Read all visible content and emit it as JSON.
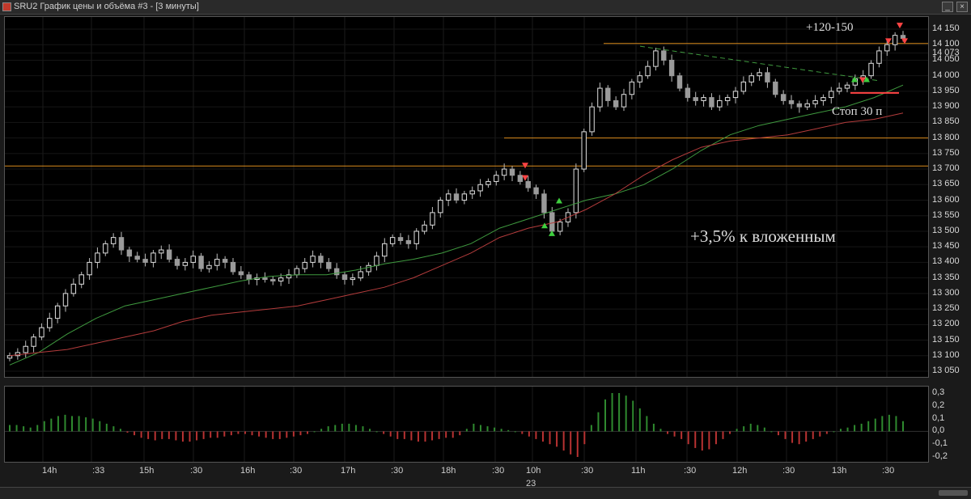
{
  "window": {
    "title": "SRU2 График цены и объёма #3 - [3 минуты]",
    "minimize_label": "_",
    "close_label": "×"
  },
  "price_panel": {
    "y_ticks": [
      "14 150",
      "14 100",
      "14 073",
      "14 050",
      "14 000",
      "13 950",
      "13 900",
      "13 850",
      "13 800",
      "13 750",
      "13 700",
      "13 650",
      "13 600",
      "13 550",
      "13 500",
      "13 450",
      "13 400",
      "13 350",
      "13 300",
      "13 250",
      "13 200",
      "13 150",
      "13 100",
      "13 050"
    ],
    "y_tick_values": [
      14150,
      14100,
      14073,
      14050,
      14000,
      13950,
      13900,
      13850,
      13800,
      13750,
      13700,
      13650,
      13600,
      13550,
      13500,
      13450,
      13400,
      13350,
      13300,
      13250,
      13200,
      13150,
      13100,
      13050
    ],
    "annotations": {
      "target": "+120-150",
      "stop": "Стоп 30 п",
      "result": "+3,5% к вложенным"
    },
    "colors": {
      "target": "#4fb84f",
      "stop": "#ff4444",
      "result": "#ff9a1f",
      "level_lines": "#d98a1c",
      "ma_fast": "#3f9a3f",
      "ma_slow": "#b43c3c",
      "candle_up": "#e0e0e0",
      "candle_down": "#9a9a9a"
    }
  },
  "osc_panel": {
    "y_ticks": [
      "0,3",
      "0,2",
      "0,1",
      "0,0",
      "-0,1",
      "-0,2"
    ],
    "y_tick_values": [
      0.3,
      0.2,
      0.1,
      0.0,
      -0.1,
      -0.2
    ],
    "colors": {
      "positive": "#2f8a2f",
      "negative": "#b83232"
    }
  },
  "x_axis": {
    "ticks": [
      "14h",
      ":33",
      "15h",
      ":30",
      "16h",
      ":30",
      "17h",
      ":30",
      "18h",
      ":30",
      "10h",
      ":30",
      "11h",
      ":30",
      "12h",
      ":30",
      "13h",
      ":30"
    ],
    "date_label": "23"
  },
  "chart_data": [
    {
      "type": "candlestick",
      "title": "",
      "symbol": "SRU2",
      "timeframe": "3 минуты",
      "ylim": [
        13040,
        14170
      ],
      "levels": [
        14104,
        13800,
        13710
      ],
      "series_candles_close_approx": [
        13100,
        13110,
        13130,
        13160,
        13190,
        13220,
        13260,
        13300,
        13330,
        13360,
        13400,
        13430,
        13460,
        13480,
        13440,
        13420,
        13410,
        13400,
        13430,
        13440,
        13410,
        13390,
        13400,
        13420,
        13380,
        13390,
        13410,
        13400,
        13370,
        13360,
        13345,
        13350,
        13345,
        13340,
        13350,
        13360,
        13380,
        13400,
        13420,
        13400,
        13380,
        13360,
        13345,
        13350,
        13370,
        13390,
        13420,
        13460,
        13480,
        13470,
        13460,
        13500,
        13520,
        13560,
        13600,
        13620,
        13600,
        13620,
        13630,
        13650,
        13660,
        13680,
        13700,
        13680,
        13660,
        13640,
        13620,
        13560,
        13500,
        13530,
        13560,
        13700,
        13820,
        13900,
        13960,
        13920,
        13900,
        13940,
        13980,
        14000,
        14030,
        14080,
        14050,
        14000,
        13960,
        13930,
        13920,
        13930,
        13900,
        13920,
        13930,
        13950,
        13980,
        14000,
        14010,
        13980,
        13940,
        13920,
        13910,
        13900,
        13910,
        13920,
        13930,
        13950,
        13960,
        13970,
        13990,
        14000,
        14040,
        14080,
        14100,
        14130,
        14120
      ],
      "ma_fast_approx": [
        13070,
        13110,
        13170,
        13220,
        13260,
        13280,
        13300,
        13320,
        13340,
        13355,
        13360,
        13360,
        13375,
        13395,
        13410,
        13430,
        13460,
        13510,
        13540,
        13570,
        13600,
        13620,
        13650,
        13700,
        13760,
        13810,
        13840,
        13860,
        13880,
        13900,
        13930,
        13970
      ],
      "ma_slow_approx": [
        13100,
        13110,
        13120,
        13140,
        13160,
        13180,
        13210,
        13230,
        13240,
        13250,
        13260,
        13280,
        13300,
        13320,
        13350,
        13390,
        13430,
        13480,
        13510,
        13530,
        13570,
        13620,
        13680,
        13730,
        13770,
        13790,
        13800,
        13810,
        13830,
        13850,
        13860,
        13880
      ],
      "annotations": [
        "+120-150",
        "Стоп 30 п",
        "+3,5% к вложенным"
      ]
    },
    {
      "type": "bar",
      "title": "",
      "ylim": [
        -0.25,
        0.35
      ],
      "values_approx": [
        0.05,
        0.05,
        0.04,
        0.03,
        0.05,
        0.08,
        0.1,
        0.12,
        0.13,
        0.12,
        0.12,
        0.11,
        0.1,
        0.08,
        0.06,
        0.04,
        0.02,
        -0.01,
        -0.03,
        -0.05,
        -0.06,
        -0.07,
        -0.06,
        -0.06,
        -0.07,
        -0.08,
        -0.08,
        -0.07,
        -0.06,
        -0.05,
        -0.05,
        -0.04,
        -0.03,
        -0.02,
        -0.02,
        -0.03,
        -0.04,
        -0.05,
        -0.06,
        -0.06,
        -0.05,
        -0.04,
        -0.03,
        -0.02,
        0.0,
        0.02,
        0.04,
        0.05,
        0.06,
        0.06,
        0.05,
        0.04,
        0.02,
        0.0,
        -0.02,
        -0.04,
        -0.06,
        -0.06,
        -0.07,
        -0.08,
        -0.08,
        -0.07,
        -0.06,
        -0.05,
        -0.05,
        -0.03,
        0.02,
        0.06,
        0.05,
        0.04,
        0.03,
        0.02,
        0.01,
        0.0,
        -0.02,
        -0.04,
        -0.06,
        -0.08,
        -0.1,
        -0.12,
        -0.15,
        -0.18,
        -0.2,
        -0.1,
        0.05,
        0.15,
        0.25,
        0.3,
        0.3,
        0.28,
        0.24,
        0.18,
        0.12,
        0.06,
        0.02,
        -0.02,
        -0.04,
        -0.06,
        -0.1,
        -0.13,
        -0.15,
        -0.14,
        -0.1,
        -0.06,
        -0.02,
        0.02,
        0.04,
        0.06,
        0.05,
        0.03,
        0.0,
        -0.03,
        -0.06,
        -0.09,
        -0.1,
        -0.08,
        -0.06,
        -0.04,
        -0.02,
        0.0,
        0.02,
        0.03,
        0.05,
        0.06,
        0.08,
        0.1,
        0.12,
        0.13,
        0.12,
        0.08
      ]
    }
  ]
}
